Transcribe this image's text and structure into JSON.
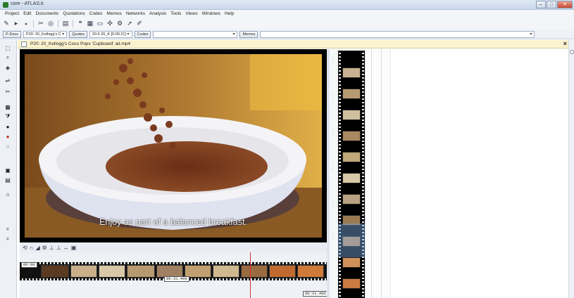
{
  "window": {
    "title": "core - ATLAS.ti",
    "minimize_glyph": "–",
    "maximize_glyph": "□",
    "close_glyph": "✕"
  },
  "menu": [
    "Project",
    "Edit",
    "Documents",
    "Quotations",
    "Codes",
    "Memos",
    "Networks",
    "Analysis",
    "Tools",
    "Views",
    "Windows",
    "Help"
  ],
  "docbar": {
    "p_docs": "P-Docs",
    "doc_combo": "P20: 20_Kellogg's C",
    "quotes": "Quotes",
    "quote_combo": "20:6 20_K [0:00:21]",
    "codes": "Codes",
    "memos": "Memos"
  },
  "document": {
    "title": "P20: 20_Kellogg's Coco Pops 'Cupboard' ad.mp4",
    "close_glyph": "×"
  },
  "video": {
    "subtitle": "Enjoy as part of a balanced breakfast."
  },
  "timeline": {
    "start_time": "00:00",
    "cursor_time": "00:31.400",
    "end_time": "00:31.400"
  },
  "icons": {
    "toolbar": [
      "new-doc-icon",
      "open-icon",
      "save-icon",
      "cut-icon",
      "binoculars-icon",
      "print-icon",
      "quote-icon",
      "code-icon",
      "memo-icon",
      "network-icon",
      "settings-icon",
      "arrow-icon",
      "brush-icon"
    ],
    "left": [
      "select-icon",
      "zoom-icon",
      "code-tool-icon",
      "link-icon",
      "cut-tool-icon",
      "grid-icon",
      "filter-icon",
      "circle-icon",
      "record-icon",
      "list-icon",
      "frame-icon",
      "edit-icon",
      "tag-icon",
      "search-icon",
      "zoom-out-icon"
    ]
  }
}
